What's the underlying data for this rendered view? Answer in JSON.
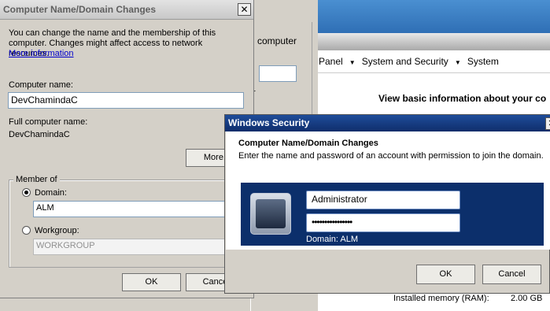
{
  "control_panel": {
    "breadcrumb": [
      "Panel",
      "System and Security",
      "System"
    ],
    "heading": "View basic information about your co",
    "installed_memory_label": "Installed memory (RAM):",
    "installed_memory_value": "2.00 GB"
  },
  "system_properties": {
    "partial_text": "computer",
    "partial_text2": "r"
  },
  "computer_name_dialog": {
    "title": "Computer Name/Domain Changes",
    "close_glyph": "✕",
    "intro": "You can change the name and the membership of this computer. Changes might affect access to network resources.",
    "more_info_link": "More information",
    "computer_name_label": "Computer name:",
    "computer_name_value": "DevChamindaC",
    "full_name_label": "Full computer name:",
    "full_name_value": "DevChamindaC",
    "more_button": "More...",
    "member_of_label": "Member of",
    "domain_label": "Domain:",
    "domain_value": "ALM",
    "workgroup_label": "Workgroup:",
    "workgroup_value": "WORKGROUP",
    "ok_button": "OK",
    "cancel_button": "Cance",
    "selected_membership": "domain"
  },
  "windows_security": {
    "title": "Windows Security",
    "close_glyph": "✕",
    "heading": "Computer Name/Domain Changes",
    "description": "Enter the name and password of an account with permission to join the domain.",
    "username_value": "Administrator",
    "password_value": "••••••••••••••••",
    "domain_text": "Domain: ALM",
    "ok_button": "OK",
    "cancel_button": "Cancel",
    "accent_color": "#0c2f6b"
  }
}
